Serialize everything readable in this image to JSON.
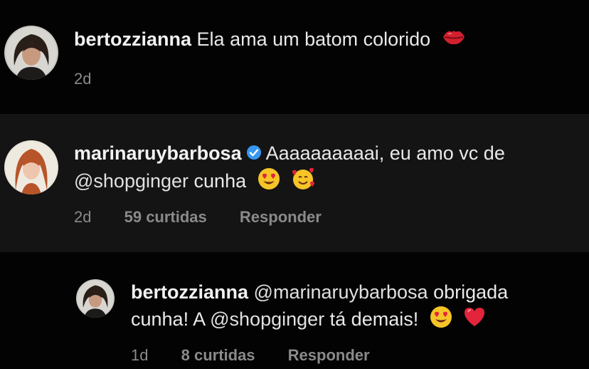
{
  "comments": [
    {
      "username": "bertozzianna",
      "text": "Ela ama um batom colorido",
      "emoji_icons": [
        "lips-kiss-icon"
      ],
      "time": "2d",
      "likes": "",
      "reply_label": ""
    },
    {
      "username": "marinaruybarbosa",
      "verified": true,
      "text_line1": "Aaaaaaaaaai, eu amo vc de",
      "mention": "@shopginger",
      "text_line2": "cunha",
      "emoji_icons": [
        "heart-eyes-emoji-icon",
        "smiling-face-with-hearts-icon"
      ],
      "time": "2d",
      "likes": "59 curtidas",
      "reply_label": "Responder"
    },
    {
      "username": "bertozzianna",
      "mention1": "@marinaruybarbosa",
      "text_after_mention1": "obrigada",
      "text_line2_start": "cunha! A",
      "mention2": "@shopginger",
      "text_line2_end": "tá demais!",
      "emoji_icons": [
        "heart-eyes-emoji-icon",
        "red-heart-icon"
      ],
      "time": "1d",
      "likes": "8 curtidas",
      "reply_label": "Responder"
    }
  ],
  "colors": {
    "background": "#000000",
    "highlight_background": "#141414",
    "text": "#e9e9e9",
    "meta": "#8a8a8a",
    "verified_badge": "#3797f0"
  }
}
